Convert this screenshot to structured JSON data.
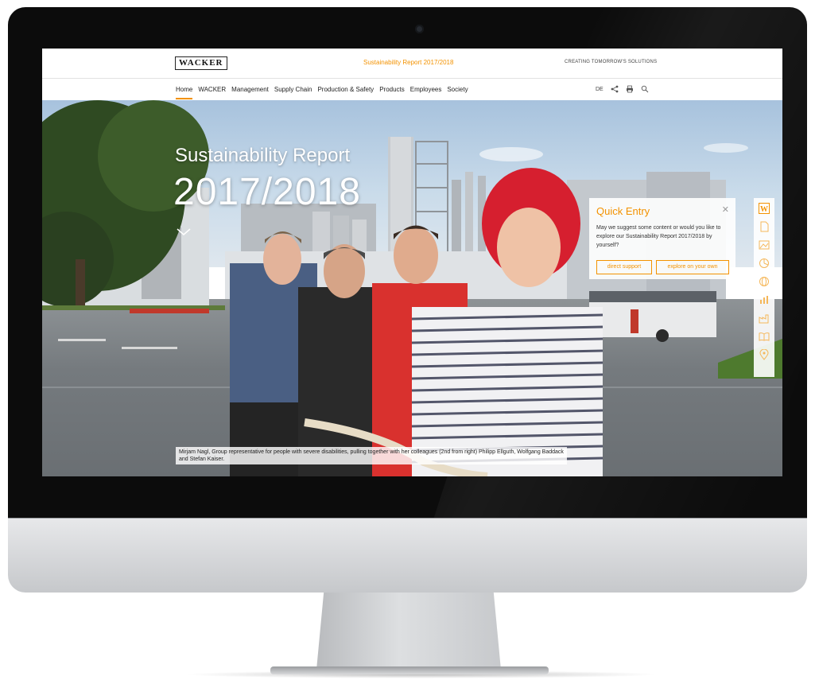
{
  "header": {
    "logo_text": "WACKER",
    "report_title": "Sustainability Report 2017/2018",
    "tagline": "CREATING TOMORROW'S SOLUTIONS"
  },
  "nav": {
    "items": [
      {
        "label": "Home",
        "active": true
      },
      {
        "label": "WACKER"
      },
      {
        "label": "Management"
      },
      {
        "label": "Supply Chain"
      },
      {
        "label": "Production & Safety"
      },
      {
        "label": "Products"
      },
      {
        "label": "Employees"
      },
      {
        "label": "Society"
      }
    ],
    "language": "DE",
    "tools": [
      "share-icon",
      "print-icon",
      "search-icon"
    ]
  },
  "hero": {
    "title_line1": "Sustainability Report",
    "title_line2": "2017/2018",
    "caption": "Mirjam Nagl, Group representative for people with severe disabilities, pulling together with her colleagues (2nd from right) Philipp Ellguth, Wolfgang Baddack and Stefan Kaiser."
  },
  "quick_entry": {
    "title": "Quick Entry",
    "text": "May we suggest some content or would you like to explore our Sustainability Report 2017/2018 by yourself?",
    "button_support": "direct support",
    "button_explore": "explore on your own"
  },
  "sidebar": {
    "icons": [
      "wacker-w-icon",
      "document-icon",
      "image-icon",
      "pie-chart-icon",
      "globe-icon",
      "bar-chart-icon",
      "factory-icon",
      "book-icon",
      "location-pin-icon"
    ]
  },
  "colors": {
    "accent": "#f39200",
    "bezel": "#0c0c0c"
  }
}
